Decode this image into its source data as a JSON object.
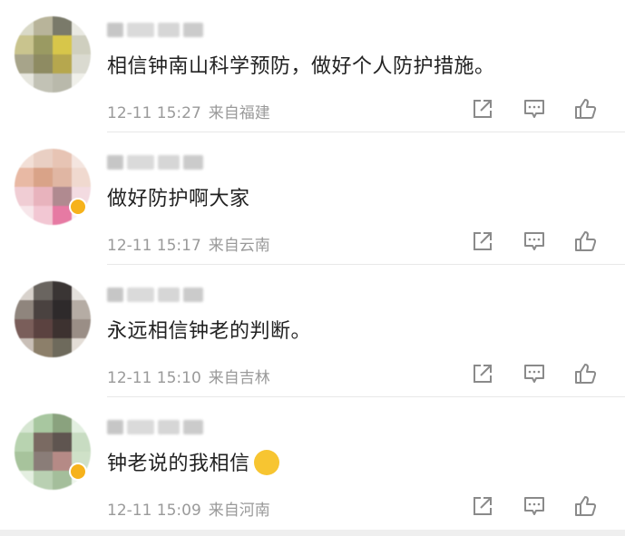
{
  "comments": [
    {
      "text": "相信钟南山科学预防，做好个人防护措施。",
      "time": "12-11 15:27",
      "location": "来自福建"
    },
    {
      "text": "做好防护啊大家",
      "time": "12-11 15:17",
      "location": "来自云南"
    },
    {
      "text": "永远相信钟老的判断。",
      "time": "12-11 15:10",
      "location": "来自吉林"
    },
    {
      "text": "钟老说的我相信",
      "time": "12-11 15:09",
      "location": "来自河南"
    }
  ],
  "icons": {
    "share": "share-icon",
    "reply": "comment-icon",
    "like": "thumbs-up-icon"
  },
  "colors": {
    "text": "#222222",
    "meta": "#9a9a9a",
    "icon": "#8a8a8a",
    "divider": "#e8e8e8",
    "vip": "#f6b21b"
  }
}
